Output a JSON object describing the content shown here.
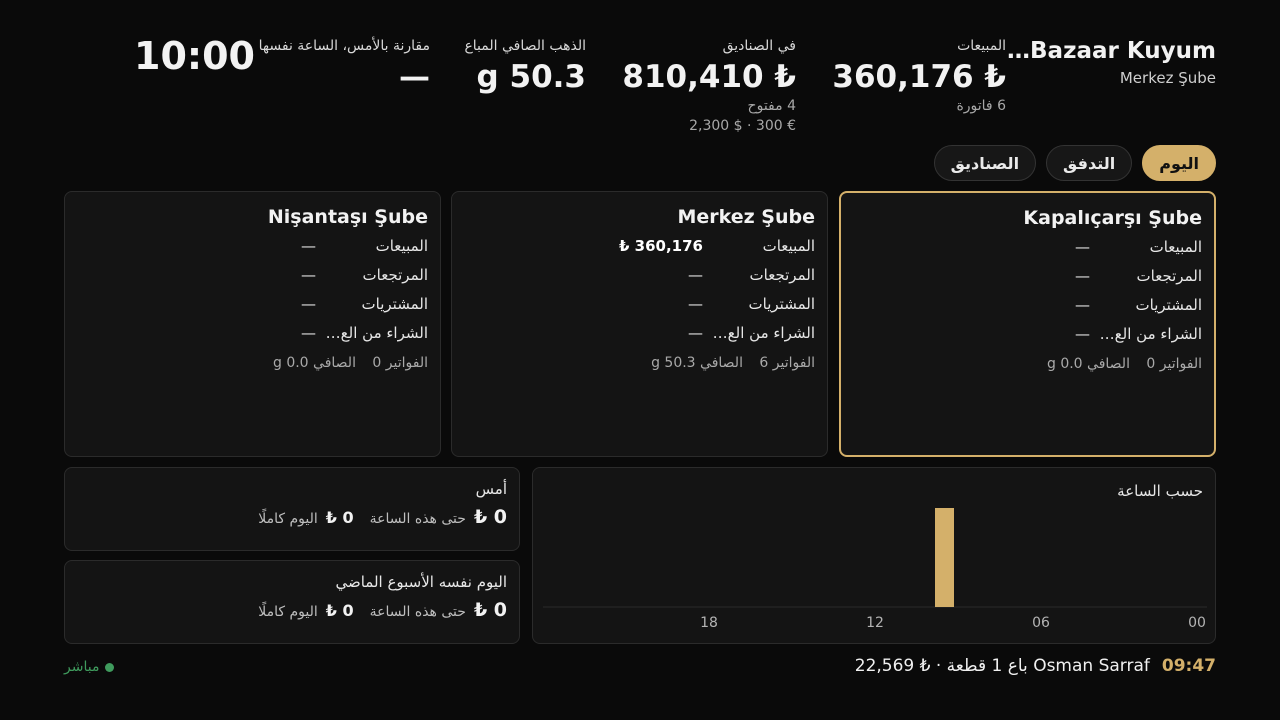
{
  "header": {
    "brand_title": "Zer Bazaar Kuyum…",
    "brand_sub": "Merkez Şube",
    "kpis": {
      "sales": {
        "label": "المبيعات",
        "value": "₺ 360,176",
        "sub": "6 فاتورة"
      },
      "funds": {
        "label": "في الصناديق",
        "value": "₺ 810,410",
        "sub": "4 مفتوح",
        "sub2": "€ 300 · $ 2,300"
      },
      "gold": {
        "label": "الذهب الصافي المباع",
        "value": "g 50.3"
      },
      "compare": {
        "label": "مقارنة بالأمس، الساعة نفسها",
        "value": "—"
      }
    },
    "clock": "10:00"
  },
  "tabs": [
    {
      "label": "اليوم",
      "active": true
    },
    {
      "label": "التدفق",
      "active": false
    },
    {
      "label": "الصناديق",
      "active": false
    }
  ],
  "branches": [
    {
      "name": "Kapalıçarşı Şube",
      "selected": true,
      "rows": [
        {
          "label": "المبيعات",
          "value": "—"
        },
        {
          "label": "المرتجعات",
          "value": "—"
        },
        {
          "label": "المشتريات",
          "value": "—"
        },
        {
          "label": "الشراء من الع…",
          "value": "—"
        }
      ],
      "invoices_label": "الفواتير 0",
      "net_label": "الصافي 0.0 g"
    },
    {
      "name": "Merkez Şube",
      "selected": false,
      "rows": [
        {
          "label": "المبيعات",
          "value": "₺ 360,176"
        },
        {
          "label": "المرتجعات",
          "value": "—"
        },
        {
          "label": "المشتريات",
          "value": "—"
        },
        {
          "label": "الشراء من الع…",
          "value": "—"
        }
      ],
      "invoices_label": "الفواتير 6",
      "net_label": "الصافي 50.3 g"
    },
    {
      "name": "Nişantaşı Şube",
      "selected": false,
      "rows": [
        {
          "label": "المبيعات",
          "value": "—"
        },
        {
          "label": "المرتجعات",
          "value": "—"
        },
        {
          "label": "المشتريات",
          "value": "—"
        },
        {
          "label": "الشراء من الع…",
          "value": "—"
        }
      ],
      "invoices_label": "الفواتير 0",
      "net_label": "الصافي 0.0 g"
    }
  ],
  "hourly": {
    "title": "حسب الساعة",
    "accent": "#d4b06a"
  },
  "chart_data": {
    "type": "bar",
    "title": "حسب الساعة",
    "x_ticks": [
      "00",
      "06",
      "12",
      "18"
    ],
    "xlim": [
      0,
      24
    ],
    "ylim": [
      0,
      360176
    ],
    "series": [
      {
        "hours": [
          9
        ],
        "values": [
          360176
        ]
      }
    ]
  },
  "compare": {
    "yesterday": {
      "title": "أمس",
      "until_now_value": "₺ 0",
      "until_now_label": "حتى هذه الساعة",
      "full_day_value": "₺ 0",
      "full_day_label": "اليوم كاملًا"
    },
    "last_week": {
      "title": "اليوم نفسه الأسبوع الماضي",
      "until_now_value": "₺ 0",
      "until_now_label": "حتى هذه الساعة",
      "full_day_value": "₺ 0",
      "full_day_label": "اليوم كاملًا"
    }
  },
  "footer": {
    "ticker_time": "09:47",
    "ticker_text": "Osman Sarraf باع 1 قطعة · ₺ 22,569",
    "live_label": "مباشر",
    "live_color": "#3f9b5d"
  }
}
